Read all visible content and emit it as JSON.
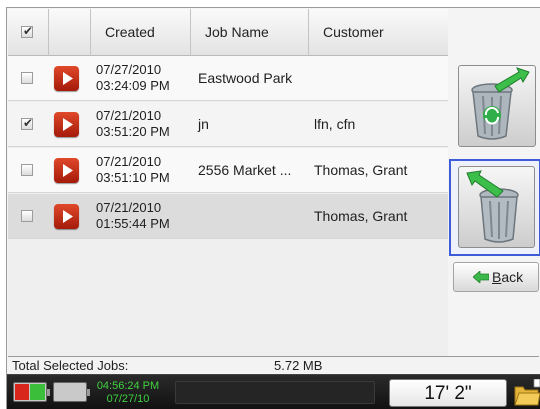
{
  "table": {
    "headers": {
      "created": "Created",
      "job_name": "Job Name",
      "customer": "Customer"
    },
    "header_checkbox_checked": true,
    "rows": [
      {
        "checked": false,
        "date": "07/27/2010",
        "time": "03:24:09 PM",
        "job_name": "Eastwood Park",
        "customer": ""
      },
      {
        "checked": true,
        "date": "07/21/2010",
        "time": "03:51:20 PM",
        "job_name": "jn",
        "customer": "lfn, cfn"
      },
      {
        "checked": false,
        "date": "07/21/2010",
        "time": "03:51:10 PM",
        "job_name": "2556 Market ...",
        "customer": "Thomas, Grant"
      },
      {
        "checked": false,
        "date": "07/21/2010",
        "time": "01:55:44 PM",
        "job_name": "",
        "customer": "Thomas, Grant"
      }
    ]
  },
  "actions": {
    "restore_icon": "recycle-bin-restore-icon",
    "delete_icon": "recycle-bin-empty-icon",
    "back_label_first": "B",
    "back_label_rest": "ack",
    "back_icon": "green-left-arrow-icon"
  },
  "summary": {
    "label": "Total Selected Jobs:",
    "value": "5.72 MB"
  },
  "status": {
    "clock_time": "04:56:24 PM",
    "clock_date": "07/27/10",
    "measurement": "17' 2\"",
    "battery_1_color": "#d9261c",
    "battery_2_color": "#c9c9c9",
    "folder_icon": "folder-icon"
  },
  "colors": {
    "accent_blue": "#3e5bd8",
    "play_red": "#c52a14",
    "clock_green": "#3fd23f"
  }
}
